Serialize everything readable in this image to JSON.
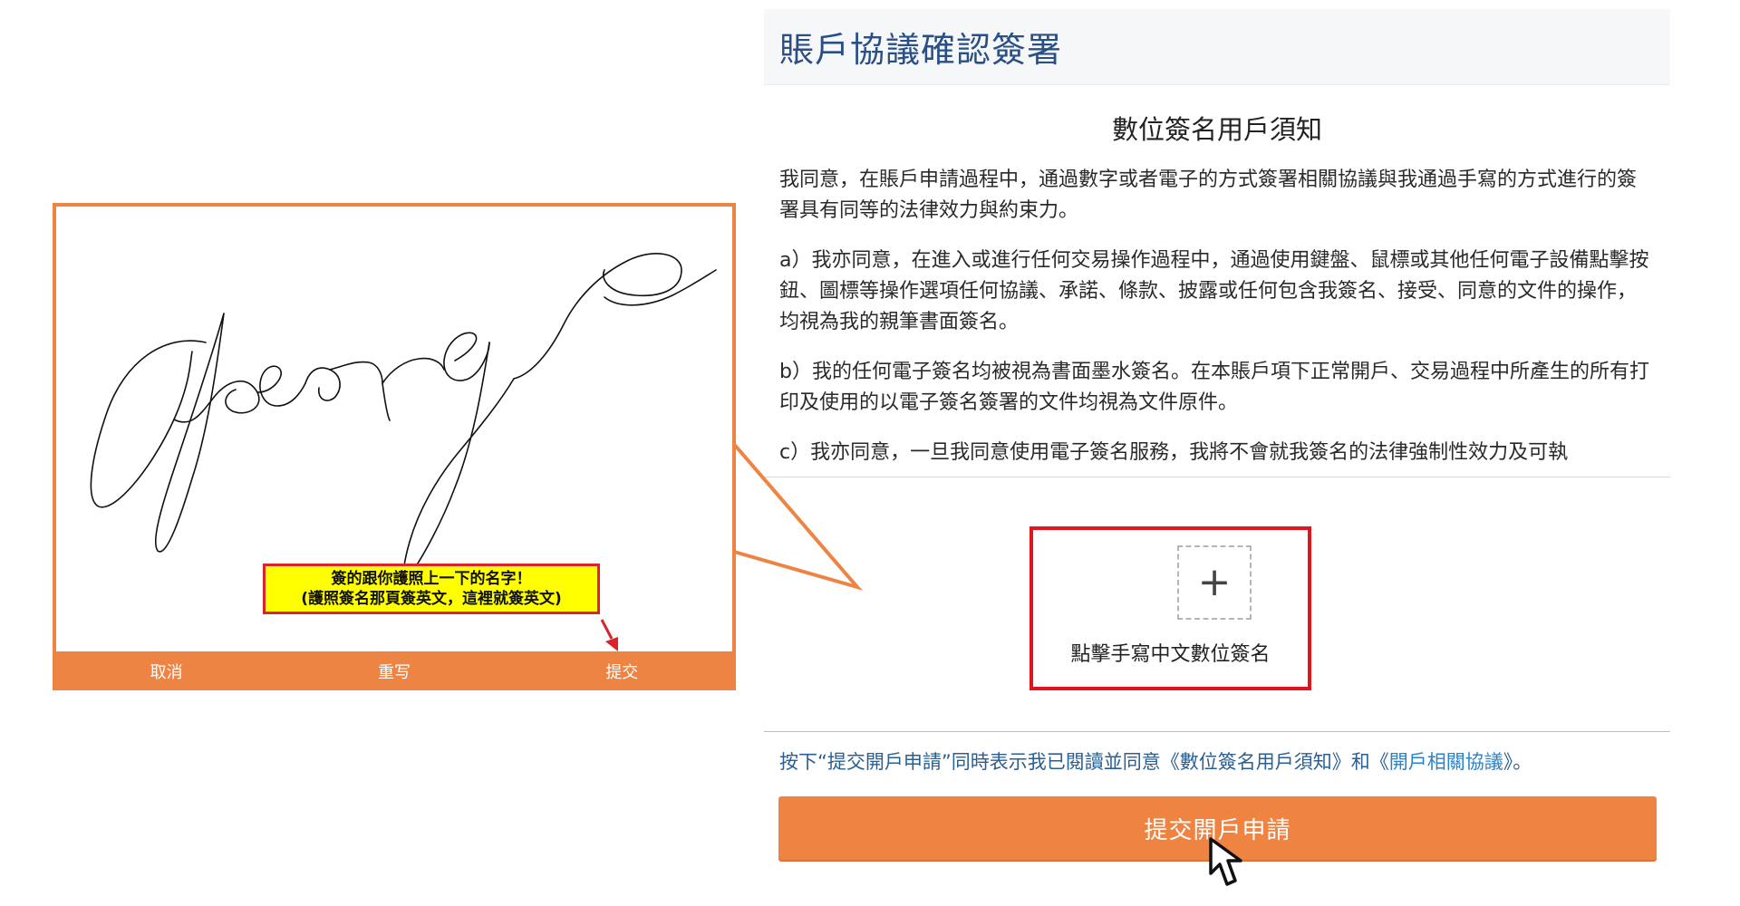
{
  "panel": {
    "title": "賬戶協議確認簽署",
    "terms_title": "數位簽名用戶須知",
    "terms_paragraphs": [
      "我同意，在賬戶申請過程中，通過數字或者電子的方式簽署相關協議與我通過手寫的方式進行的簽署具有同等的法律效力與約束力。",
      "a）我亦同意，在進入或進行任何交易操作過程中，通過使用鍵盤、鼠標或其他任何電子設備點擊按鈕、圖標等操作選項任何協議、承諾、條款、披露或任何包含我簽名、接受、同意的文件的操作，均視為我的親筆書面簽名。",
      "b）我的任何電子簽名均被視為書面墨水簽名。在本賬戶項下正常開戶、交易過程中所產生的所有打印及使用的以電子簽名簽署的文件均視為文件原件。",
      "c）我亦同意，一旦我同意使用電子簽名服務，我將不會就我簽名的法律強制性效力及可執"
    ],
    "sign_button_icon": "+",
    "sign_label": "點擊手寫中文數位簽名",
    "notice_prefix": "按下“提交開戶申請”同時表示我已閱讀並同意《數位簽名用戶須知》和《",
    "notice_link": "開戶相關協議",
    "notice_suffix": "》。",
    "submit_label": "提交開戶申請"
  },
  "popup": {
    "cancel_label": "取消",
    "rewrite_label": "重写",
    "submit_label": "提交",
    "signature_text": "George",
    "tip_line1": "簽的跟你護照上一下的名字！",
    "tip_line2": "(護照簽名那頁簽英文，這裡就簽英文)"
  },
  "colors": {
    "accent_orange": "#ee8443",
    "title_blue": "#2a4f86",
    "highlight_red": "#e0161f",
    "tip_yellow": "#ffff00"
  },
  "icons": {
    "add": "plus-icon",
    "cursor": "mouse-pointer-icon",
    "arrow": "red-arrow-icon"
  }
}
